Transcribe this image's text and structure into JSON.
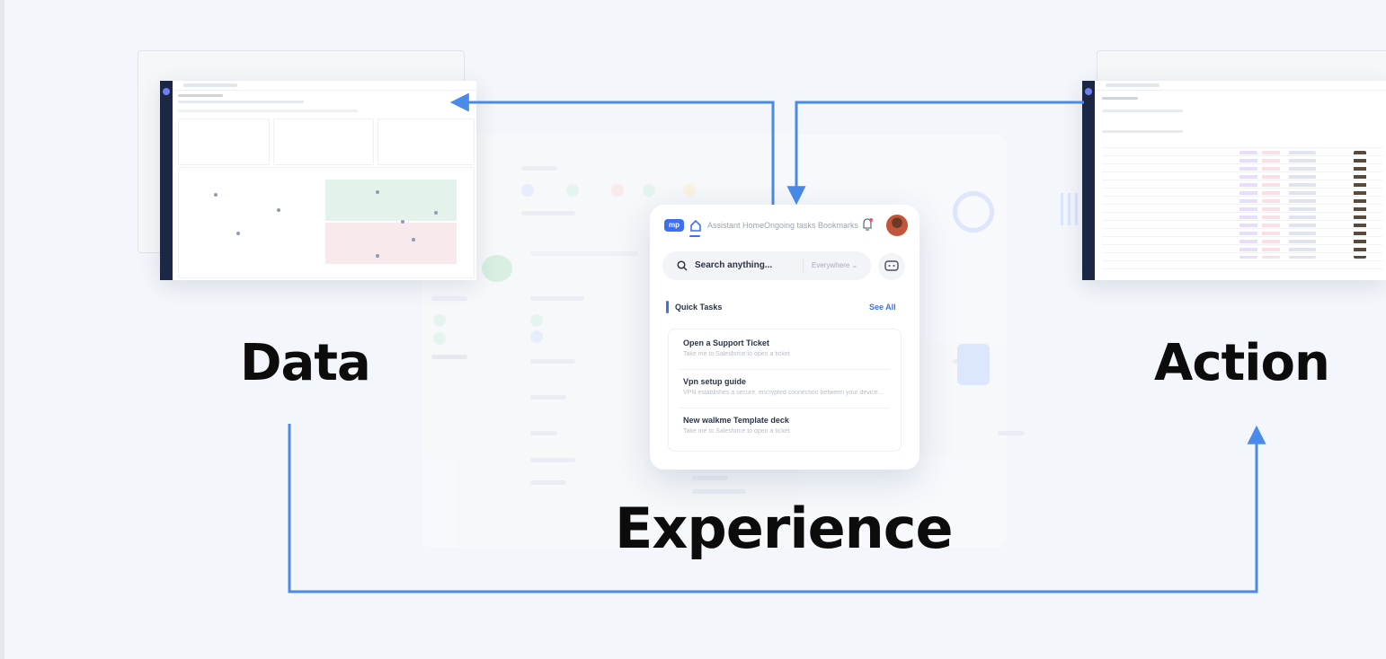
{
  "labels": {
    "data": "Data",
    "experience": "Experience",
    "action": "Action"
  },
  "center_app": {
    "logo_text": "mp",
    "nav": [
      "Assistant Home",
      "Ongoing tasks",
      "Bookmarks"
    ],
    "search": {
      "placeholder": "Search anything...",
      "scope": "Everywhere ⌄"
    },
    "quick_tasks": {
      "title": "Quick Tasks",
      "see_all": "See All",
      "items": [
        {
          "title": "Open a Support Ticket",
          "subtitle": "Take me to Salesforce to open a ticket"
        },
        {
          "title": "Vpn setup guide",
          "subtitle": "VPN establishes a secure, encrypted connection between your device..."
        },
        {
          "title": "New walkme Template deck",
          "subtitle": "Take me to Salesforce to open a ticket"
        }
      ]
    }
  },
  "colors": {
    "arrow": "#4a8ae8",
    "accent": "#3d6ff5",
    "sidebar": "#1c2746",
    "text": "#0c0c0c"
  },
  "icons": [
    "home-icon",
    "bell-icon",
    "search-icon",
    "chat-icon",
    "avatar"
  ]
}
